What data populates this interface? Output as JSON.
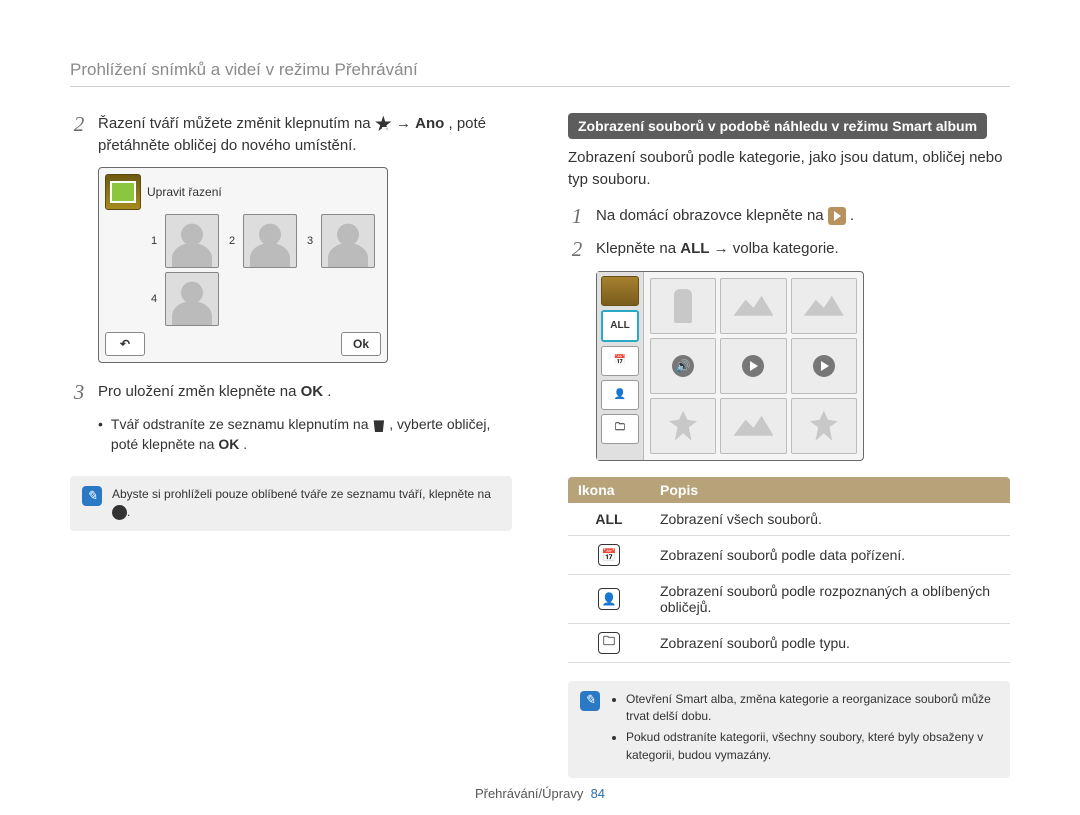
{
  "page_title": "Prohlížení snímků a videí v režimu Přehrávání",
  "left": {
    "step2a": "Řazení tváří můžete změnit klepnutím na ",
    "step2b": " → ",
    "step2_ano": "Ano",
    "step2c": ", poté přetáhněte obličej do nového umístění.",
    "ui1_title": "Upravit řazení",
    "ui1_nums": [
      "1",
      "2",
      "3",
      "4"
    ],
    "ui1_ok": "Ok",
    "step3a": "Pro uložení změn klepněte na ",
    "step3_ok": "OK",
    "step3b": ".",
    "bullet_a": "Tvář odstraníte ze seznamu klepnutím na ",
    "bullet_b": ", vyberte obličej, poté klepněte na ",
    "bullet_ok": "OK",
    "bullet_c": ".",
    "note": "Abyste si prohlíželi pouze oblíbené tváře ze seznamu tváří, klepněte na "
  },
  "right": {
    "sub": "Zobrazení souborů v podobě náhledu v režimu Smart album",
    "para": "Zobrazení souborů podle kategorie, jako jsou datum, obličej nebo typ souboru.",
    "step1a": "Na domácí obrazovce klepněte na ",
    "step1b": ".",
    "step2a": "Klepněte na ",
    "step2_all": "ALL",
    "step2b": " → volba kategorie.",
    "side_all": "ALL",
    "th_icon": "Ikona",
    "th_desc": "Popis",
    "rows": [
      {
        "icon": "ALL",
        "desc": "Zobrazení všech souborů."
      },
      {
        "icon": "date",
        "desc": "Zobrazení souborů podle data pořízení."
      },
      {
        "icon": "face",
        "desc": "Zobrazení souborů podle rozpoznaných a oblíbených obličejů."
      },
      {
        "icon": "type",
        "desc": "Zobrazení souborů podle typu."
      }
    ],
    "note_li1": "Otevření Smart alba, změna kategorie a reorganizace souborů může trvat delší dobu.",
    "note_li2": "Pokud odstraníte kategorii, všechny soubory, které byly obsaženy v kategorii, budou vymazány."
  },
  "footer_sec": "Přehrávání/Úpravy",
  "footer_page": "84"
}
